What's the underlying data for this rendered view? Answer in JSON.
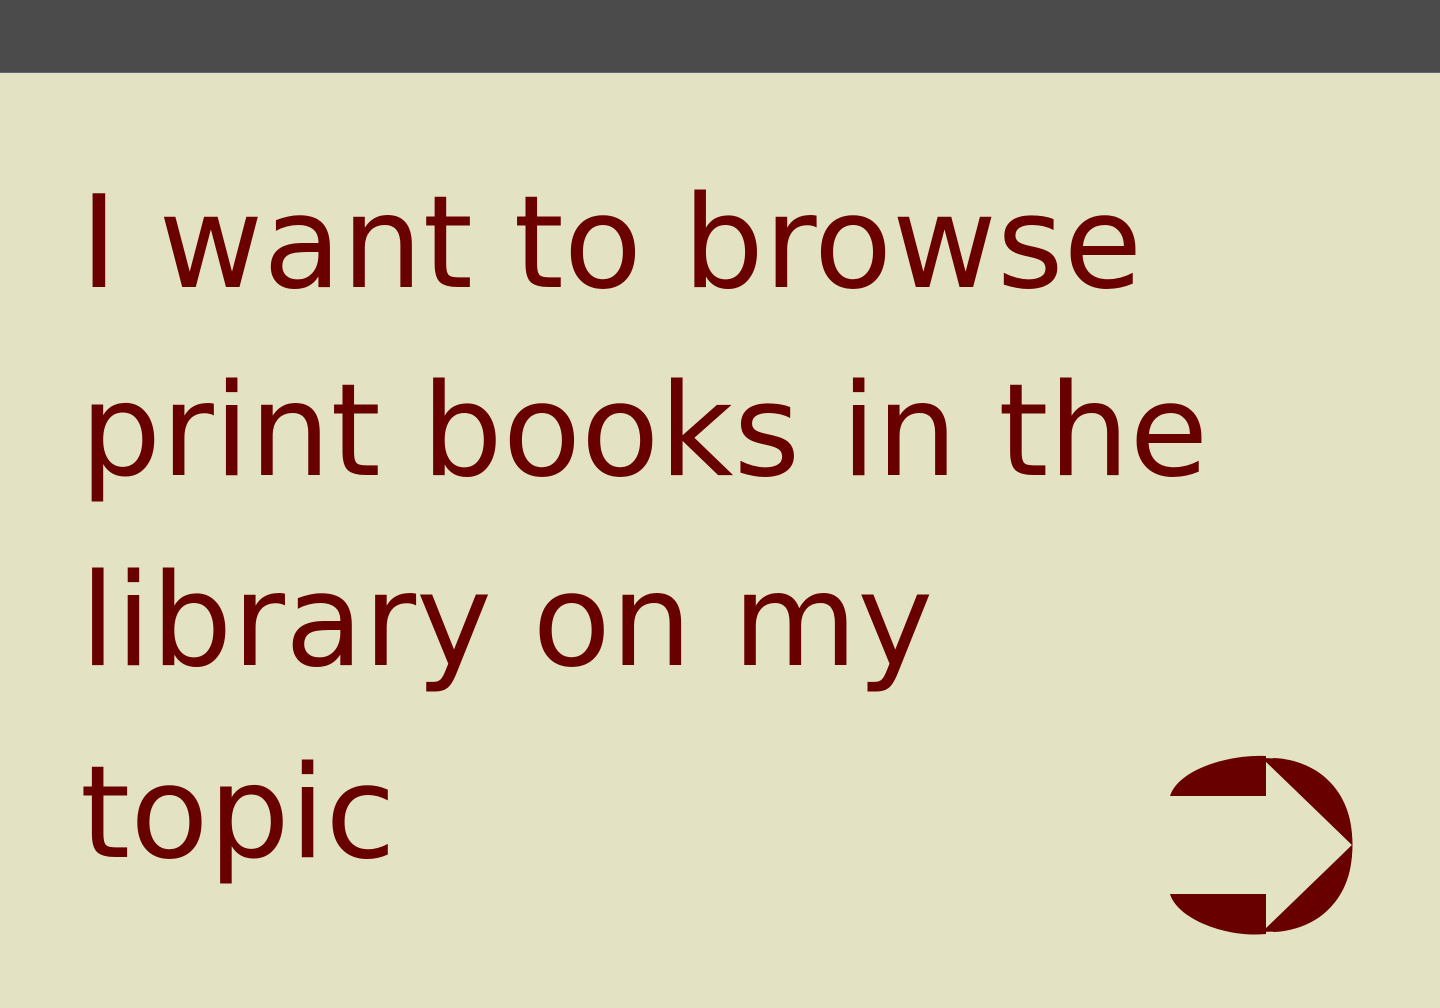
{
  "card": {
    "line1": "I want to browse",
    "line2": "print books in the",
    "line3": "library on my",
    "line4": "topic"
  },
  "colors": {
    "topbar": "#4b4b4b",
    "background": "#e3e3c3",
    "text": "#680000",
    "arrow": "#680000"
  },
  "icons": {
    "next": "arrow-right-icon"
  }
}
